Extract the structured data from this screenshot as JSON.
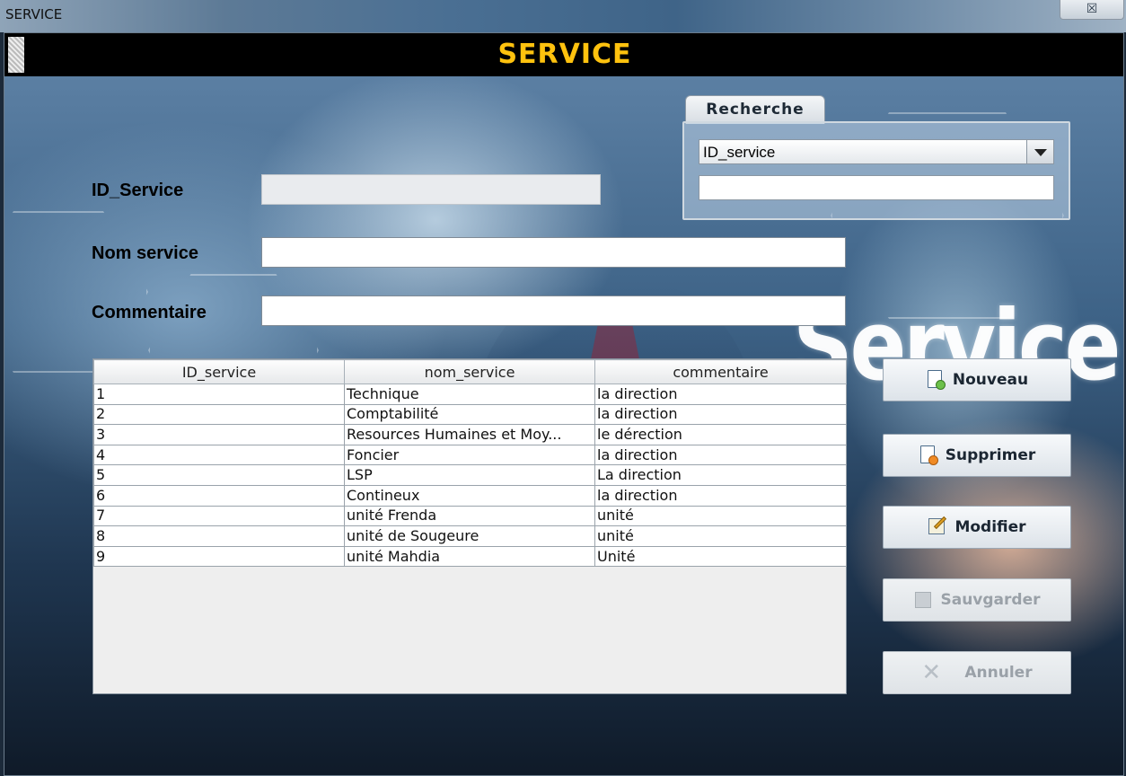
{
  "window": {
    "title": "SERVICE",
    "close_glyph": "☒"
  },
  "header": {
    "title": "SERVICE"
  },
  "background": {
    "word": "Service"
  },
  "form": {
    "id_label": "ID_Service",
    "id_value": "",
    "nom_label": "Nom service",
    "nom_value": "",
    "commentaire_label": "Commentaire",
    "commentaire_value": ""
  },
  "search": {
    "tab_label": "Recherche",
    "selected": "ID_service",
    "options": [
      "ID_service"
    ],
    "value": ""
  },
  "table": {
    "columns": [
      "ID_service",
      "nom_service",
      "commentaire"
    ],
    "rows": [
      [
        "1",
        "Technique",
        "la direction"
      ],
      [
        "2",
        "Comptabilité",
        "la direction"
      ],
      [
        "3",
        "Resources Humaines et Moy...",
        "le dérection"
      ],
      [
        "4",
        "Foncier",
        "la direction"
      ],
      [
        "5",
        "LSP",
        "La direction"
      ],
      [
        "6",
        "Contineux",
        "la direction"
      ],
      [
        "7",
        "unité Frenda",
        "unité"
      ],
      [
        "8",
        "unité de Sougeure",
        "unité"
      ],
      [
        "9",
        "unité Mahdia",
        "Unité"
      ]
    ]
  },
  "buttons": {
    "nouveau": "Nouveau",
    "supprimer": "Supprimer",
    "modifier": "Modifier",
    "sauvgarder": "Sauvgarder",
    "annuler": "Annuler"
  },
  "colors": {
    "header_bg": "#000000",
    "header_title": "#ffc20e"
  }
}
